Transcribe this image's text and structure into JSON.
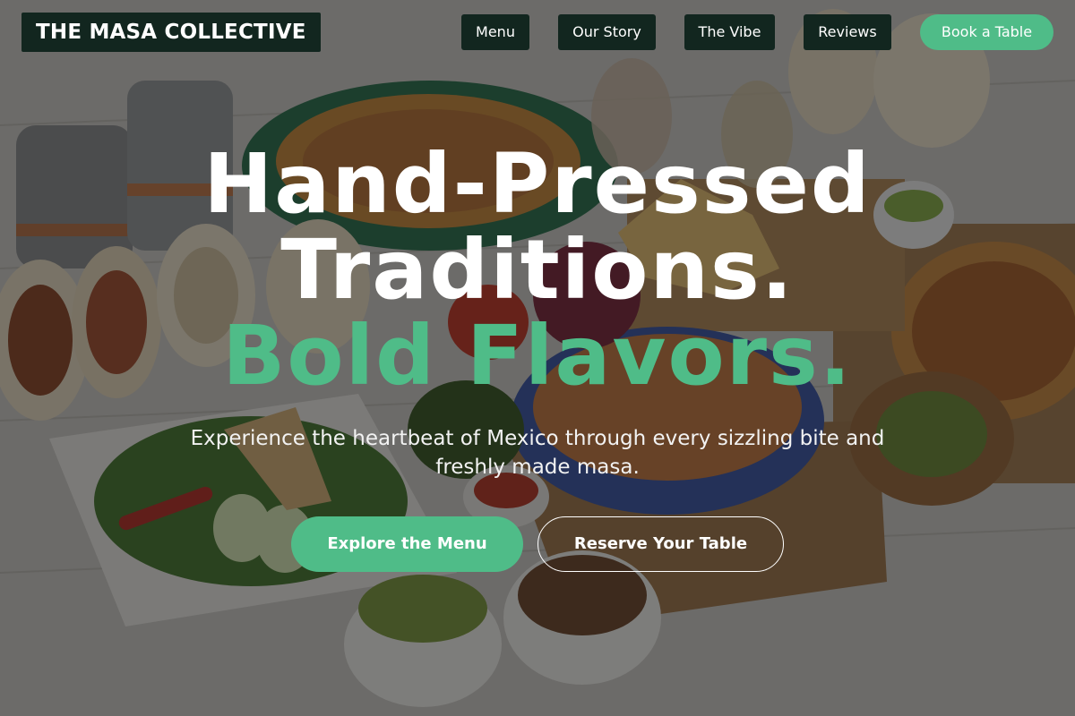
{
  "brand": {
    "name": "THE MASA COLLECTIVE"
  },
  "nav": {
    "items": [
      {
        "label": "Menu"
      },
      {
        "label": "Our Story"
      },
      {
        "label": "The Vibe"
      },
      {
        "label": "Reviews"
      }
    ],
    "cta_label": "Book a Table"
  },
  "hero": {
    "headline_line1": "Hand-Pressed",
    "headline_line2": "Traditions.",
    "headline_accent": "Bold Flavors.",
    "subtitle": "Experience the heartbeat of Mexico through every sizzling bite and freshly made masa.",
    "primary_cta": "Explore the Menu",
    "secondary_cta": "Reserve Your Table"
  },
  "colors": {
    "accent": "#4fbc88",
    "nav_background": "#12261f",
    "text": "#ffffff"
  }
}
